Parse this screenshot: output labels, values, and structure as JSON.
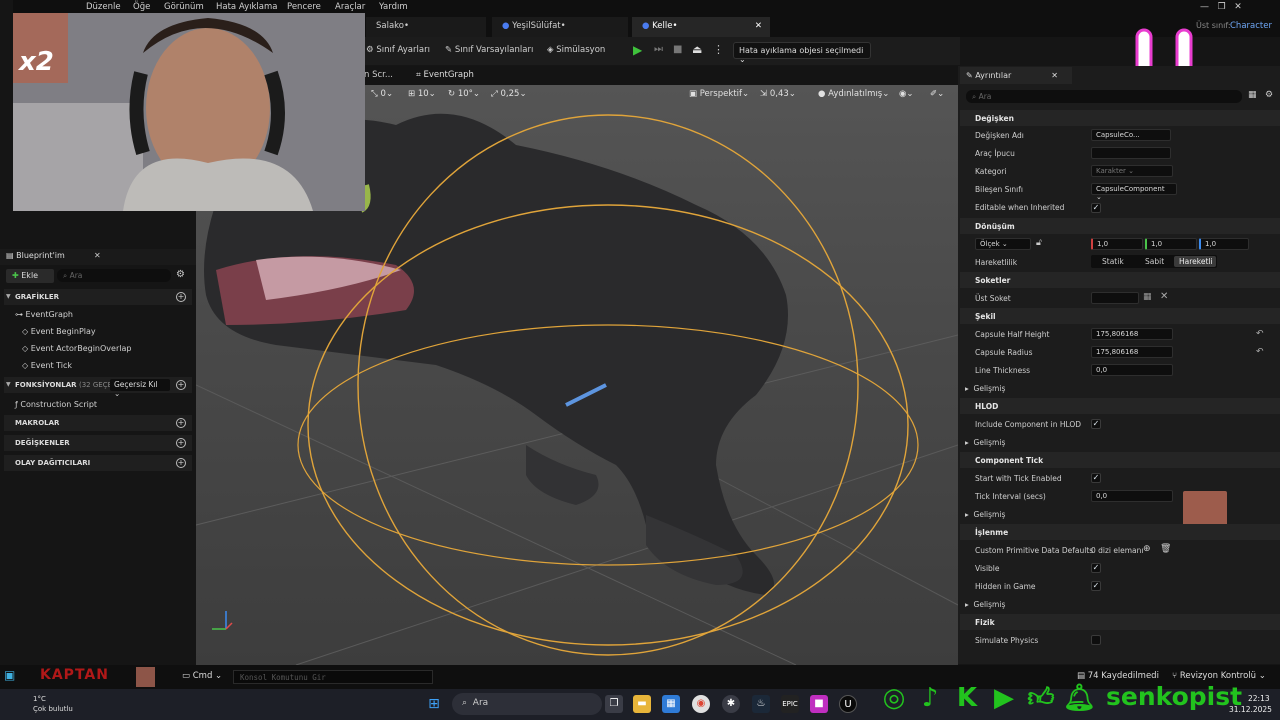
{
  "menu": [
    "Düzenle",
    "Öğe",
    "Görünüm",
    "Hata Ayıklama",
    "Pencere",
    "Araçlar",
    "Yardım"
  ],
  "parent_class": {
    "label": "Üst sınıf:",
    "value": "Character"
  },
  "tabs": [
    {
      "label": "Salako•"
    },
    {
      "label": "YeşilSülüfat•"
    },
    {
      "label": "Kelle•"
    }
  ],
  "toolbar": {
    "class_settings": "Sınıf Ayarları",
    "class_defaults": "Sınıf Varsayılanları",
    "simulation": "Simülasyon",
    "debug_object": "Hata ayıklama objesi seçilmedi"
  },
  "subtabs": {
    "construction": "n Scr...",
    "eventgraph": "EventGraph"
  },
  "viewport_bar": {
    "rot": "0",
    "grid": "10",
    "angle": "10°",
    "scale": "0,25",
    "perspective": "Perspektif",
    "speed": "0,43",
    "lighting": "Aydınlatılmış"
  },
  "webcam": {
    "badge": "x2"
  },
  "blueprint": {
    "title": "Blueprint'im",
    "add": "Ekle",
    "search_placeholder": "Ara",
    "graphs_section": "GRAFİKLER",
    "eventgraph": "EventGraph",
    "events": [
      "Event BeginPlay",
      "Event ActorBeginOverlap",
      "Event Tick"
    ],
    "functions_section": "FONKSİYONLAR",
    "functions_count": "(32 GEÇERS",
    "override": "Geçersiz Kıl",
    "construction_script": "Construction Script",
    "macros": "MAKROLAR",
    "variables": "DEĞİŞKENLER",
    "dispatchers": "OLAY DAĞITICILARI"
  },
  "details": {
    "title": "Ayrıntılar",
    "search_placeholder": "Ara",
    "variable_section": "Değişken",
    "variable_name_label": "Değişken Adı",
    "variable_name_value": "CapsuleCo...",
    "tooltip_label": "Araç İpucu",
    "category_label": "Kategori",
    "category_value": "Karakter",
    "component_class_label": "Bileşen Sınıfı",
    "component_class_value": "CapsuleComponent",
    "editable_inherited": "Editable when Inherited",
    "transform_section": "Dönüşüm",
    "scale_label": "Ölçek",
    "scale_values": [
      "1,0",
      "1,0",
      "1,0"
    ],
    "mobility_label": "Hareketlilik",
    "mobility_options": [
      "Statik",
      "Sabit",
      "Hareketli"
    ],
    "sockets_section": "Soketler",
    "parent_socket": "Üst Soket",
    "shape_section": "Şekil",
    "capsule_half_height_label": "Capsule Half Height",
    "capsule_half_height": "175,806168",
    "capsule_radius_label": "Capsule Radius",
    "capsule_radius": "175,806168",
    "line_thickness_label": "Line Thickness",
    "line_thickness": "0,0",
    "advanced": "Gelişmiş",
    "hlod_section": "HLOD",
    "include_hlod": "Include Component in HLOD",
    "tick_section": "Component Tick",
    "start_tick": "Start with Tick Enabled",
    "tick_interval_label": "Tick Interval (secs)",
    "tick_interval": "0,0",
    "rendering_section": "İşlenme",
    "custom_primitive": "Custom Primitive Data Defaults",
    "array_elements": "0 dizi elemanı",
    "visible": "Visible",
    "hidden_in_game": "Hidden in Game",
    "physics_section": "Fizik",
    "simulate_physics": "Simulate Physics"
  },
  "statusbar": {
    "cmd": "Cmd",
    "console_placeholder": "Konsol Komutunu Gir",
    "saved": "74 Kaydedilmedi",
    "revision": "Revizyon Kontrolü"
  },
  "overlay": {
    "kaptan": "KAPTAN",
    "brand": "senkopist"
  },
  "taskbar": {
    "search": "Ara",
    "temp": "1°C",
    "weather": "Çok bulutlu",
    "time": "22:13",
    "date": "31.12.2025"
  },
  "colors": {
    "accent": "#2f8cf0",
    "capsule": "#e0a43a",
    "brand_green": "#22c31e",
    "pink": "#e83ccf"
  }
}
